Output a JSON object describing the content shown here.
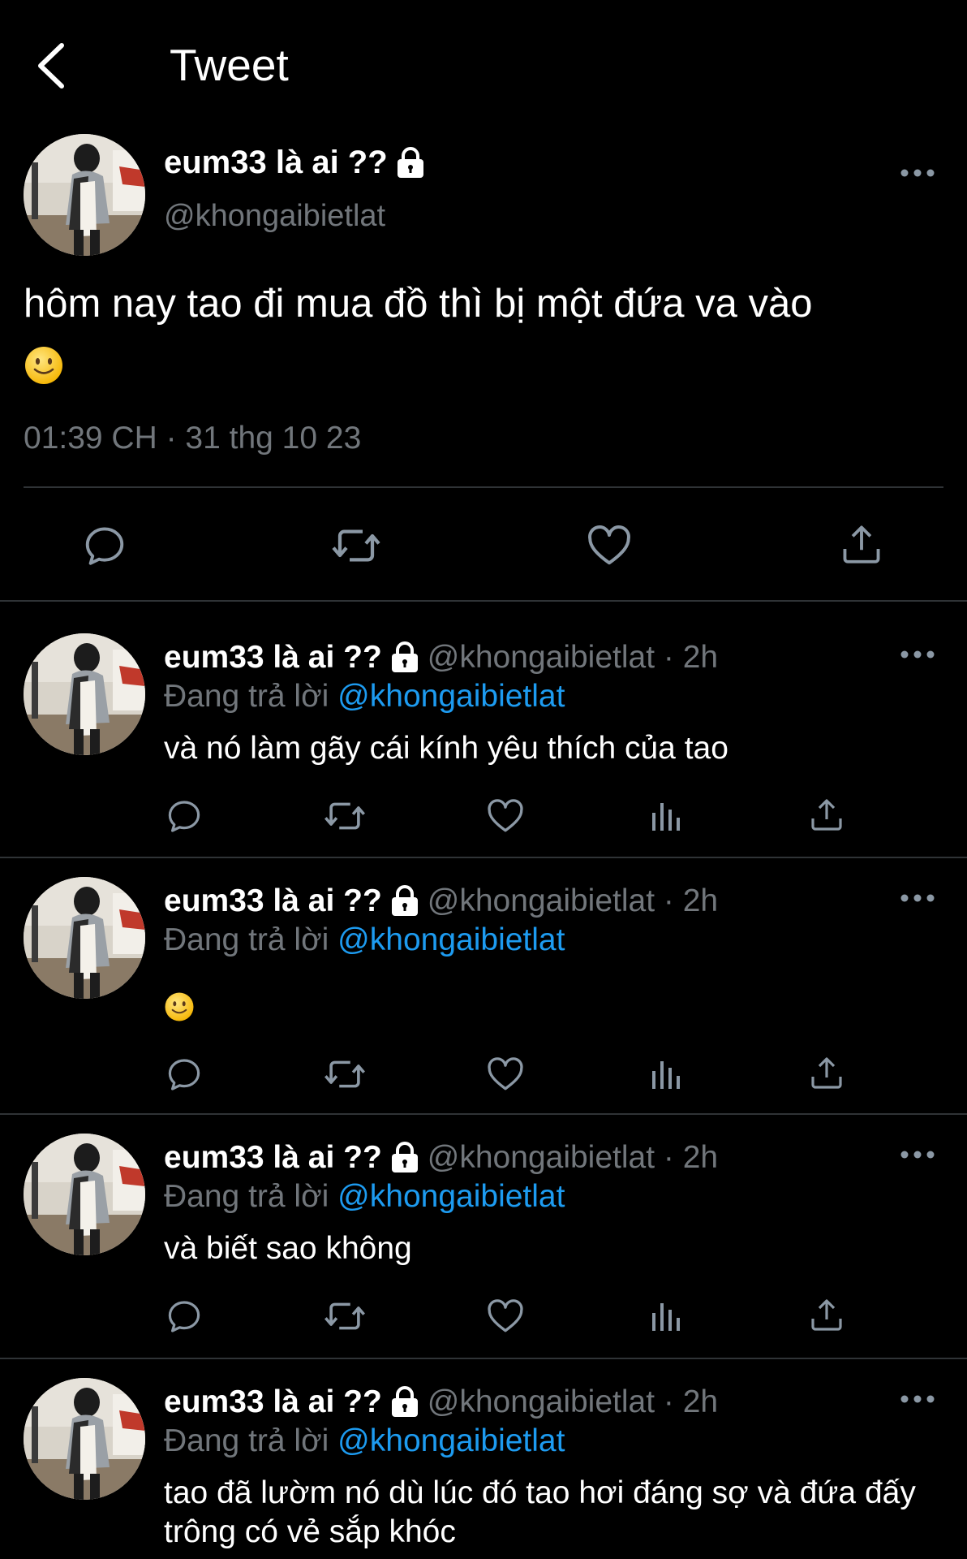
{
  "header": {
    "title": "Tweet",
    "back_icon": "chevron-left-icon"
  },
  "main_tweet": {
    "display_name": "eum33 là ai ??",
    "handle": "@khongaibietlat",
    "text": "hôm nay tao đi mua đồ thì bị một đứa va vào",
    "emoji": "slightly-smiling-face",
    "timestamp": "01:39 CH · 31 thg 10 23",
    "actions": [
      "reply-icon",
      "retweet-icon",
      "like-icon",
      "share-icon"
    ]
  },
  "replies": [
    {
      "display_name": "eum33 là ai ??",
      "handle_time": "@khongaibietlat · 2h",
      "replying_prefix": "Đang trả lời",
      "replying_to": "@khongaibietlat",
      "text": "và nó làm gãy cái kính yêu thích của tao"
    },
    {
      "display_name": "eum33 là ai ??",
      "handle_time": "@khongaibietlat · 2h",
      "replying_prefix": "Đang trả lời",
      "replying_to": "@khongaibietlat",
      "text": "",
      "emoji": "slightly-smiling-face"
    },
    {
      "display_name": "eum33 là ai ??",
      "handle_time": "@khongaibietlat · 2h",
      "replying_prefix": "Đang trả lời",
      "replying_to": "@khongaibietlat",
      "text": "và biết sao không"
    },
    {
      "display_name": "eum33 là ai ??",
      "handle_time": "@khongaibietlat · 2h",
      "replying_prefix": "Đang trả lời",
      "replying_to": "@khongaibietlat",
      "text": "tao đã lườm nó dù lúc đó tao hơi đáng sợ và đứa đấy trông có vẻ sắp khóc"
    }
  ],
  "colors": {
    "background": "#000000",
    "text_primary": "#ffffff",
    "text_secondary": "#71767b",
    "link": "#1d9bf0",
    "divider": "#2f3336"
  }
}
